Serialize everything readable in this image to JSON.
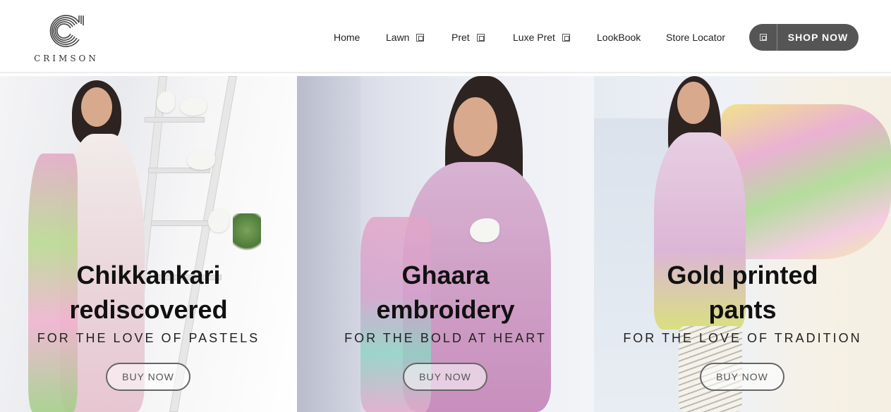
{
  "brand": {
    "name": "CRIMSON",
    "logo_icon": "crimson-c-logo-icon"
  },
  "nav": {
    "items": [
      {
        "label": "Home",
        "has_dropdown": false
      },
      {
        "label": "Lawn",
        "has_dropdown": true
      },
      {
        "label": "Pret",
        "has_dropdown": true
      },
      {
        "label": "Luxe Pret",
        "has_dropdown": true
      },
      {
        "label": "LookBook",
        "has_dropdown": false
      },
      {
        "label": "Store Locator",
        "has_dropdown": false
      }
    ],
    "shop_now": {
      "label": "SHOP NOW",
      "icon": "grid-icon",
      "color": "#555555"
    }
  },
  "panels": [
    {
      "title_line1": "Chikkankari",
      "title_line2": "rediscovered",
      "subtitle": "FOR THE LOVE OF PASTELS",
      "button": "BUY NOW"
    },
    {
      "title_line1": "Ghaara",
      "title_line2": "embroidery",
      "subtitle": "FOR THE BOLD AT HEART",
      "button": "BUY NOW"
    },
    {
      "title_line1": "Gold printed",
      "title_line2": "pants",
      "subtitle": "FOR THE LOVE OF TRADITION",
      "button": "BUY NOW"
    }
  ]
}
